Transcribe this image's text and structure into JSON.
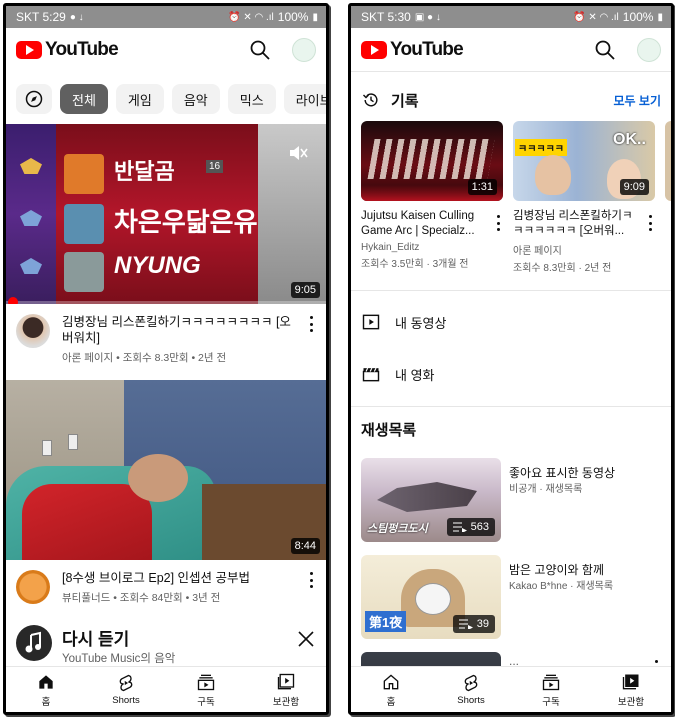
{
  "left": {
    "status": {
      "time": "SKT 5:29",
      "battery": "100%"
    },
    "app_title": "YouTube",
    "chips": [
      "전체",
      "게임",
      "음악",
      "믹스",
      "라이브"
    ],
    "video1": {
      "thumb_lines": [
        "반달곰",
        "차은우닮은유",
        "NYUNG"
      ],
      "badge_16": "16",
      "duration": "9:05",
      "title": "김병장님 리스폰킬하기ㅋㅋㅋㅋㅋㅋㅋㅋ [오버워치]",
      "meta": "아론 페이지 • 조회수 8.3만회 • 2년 전"
    },
    "video2": {
      "duration": "8:44",
      "title": "[8수생 브이로그 Ep2] 인셉션 공부법",
      "meta": "뷰티풀너드 • 조회수 84만회 • 3년 전"
    },
    "listen_again": {
      "title": "다시 듣기",
      "subtitle": "YouTube Music의 음악"
    },
    "nav": [
      "홈",
      "Shorts",
      "구독",
      "보관함"
    ]
  },
  "right": {
    "status": {
      "time": "SKT 5:30",
      "battery": "100%"
    },
    "app_title": "YouTube",
    "history": {
      "title": "기록",
      "see_all": "모두 보기",
      "items": [
        {
          "duration": "1:31",
          "title": "Jujutsu Kaisen Culling Game Arc | Specialz...",
          "channel": "Hykain_Editz",
          "meta": "조회수 3.5만회 · 3개월 전"
        },
        {
          "duration": "9:09",
          "title": "김병장님 리스폰킬하기ㅋㅋㅋㅋㅋㅋㅋ [오버워...",
          "channel": "아론 페이지",
          "meta": "조회수 8.3만회 · 2년 전",
          "thumb_text": "ㅋㅋㅋㅋㅋ",
          "thumb_text2": "OK.."
        }
      ]
    },
    "my_videos": "내 동영상",
    "my_movies": "내 영화",
    "playlists": {
      "title": "재생목록",
      "items": [
        {
          "title": "좋아요 표시한 동영상",
          "sub": "비공개 · 재생목록",
          "count": "563",
          "thumb_text": "스팀펑크도시"
        },
        {
          "title": "밤은 고양이와 함께",
          "sub": "Kakao B*hne · 재생목록",
          "count": "39",
          "thumb_text": "第1夜"
        }
      ]
    },
    "nav": [
      "홈",
      "Shorts",
      "구독",
      "보관함"
    ]
  },
  "colors": {
    "brand_red": "#ff0000",
    "link_blue": "#065fd4",
    "chip_active": "#606060"
  }
}
